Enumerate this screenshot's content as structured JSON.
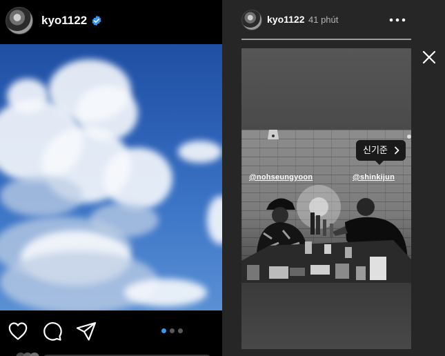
{
  "post": {
    "username": "kyo1122",
    "avatar": "profile-avatar",
    "verified_icon": "verified-badge-icon",
    "actions": [
      {
        "name": "like",
        "icon": "heart-icon"
      },
      {
        "name": "comment",
        "icon": "comment-bubble-icon"
      },
      {
        "name": "share",
        "icon": "paper-plane-icon"
      }
    ],
    "carousel": {
      "slides": 3,
      "active": 1
    },
    "image": "blue-sky-with-clouds-photo"
  },
  "story": {
    "username": "kyo1122",
    "time": "41 phút",
    "more_icon": "more-options-icon",
    "close_icon": "close-icon",
    "progress": 1,
    "tags": [
      "@nohseungyoon",
      "@shinkijun"
    ],
    "mention_popup": "신기준",
    "mention_popup_icon": "chevron-right-icon",
    "image": "black-and-white-restaurant-photo"
  },
  "colors": {
    "background": "#000000",
    "story_panel": "#262626",
    "verified_blue": "#3897f0",
    "active_dot": "#3897f0",
    "inactive_dot": "#5a5a5a",
    "secondary_text": "#b4b4b4"
  }
}
